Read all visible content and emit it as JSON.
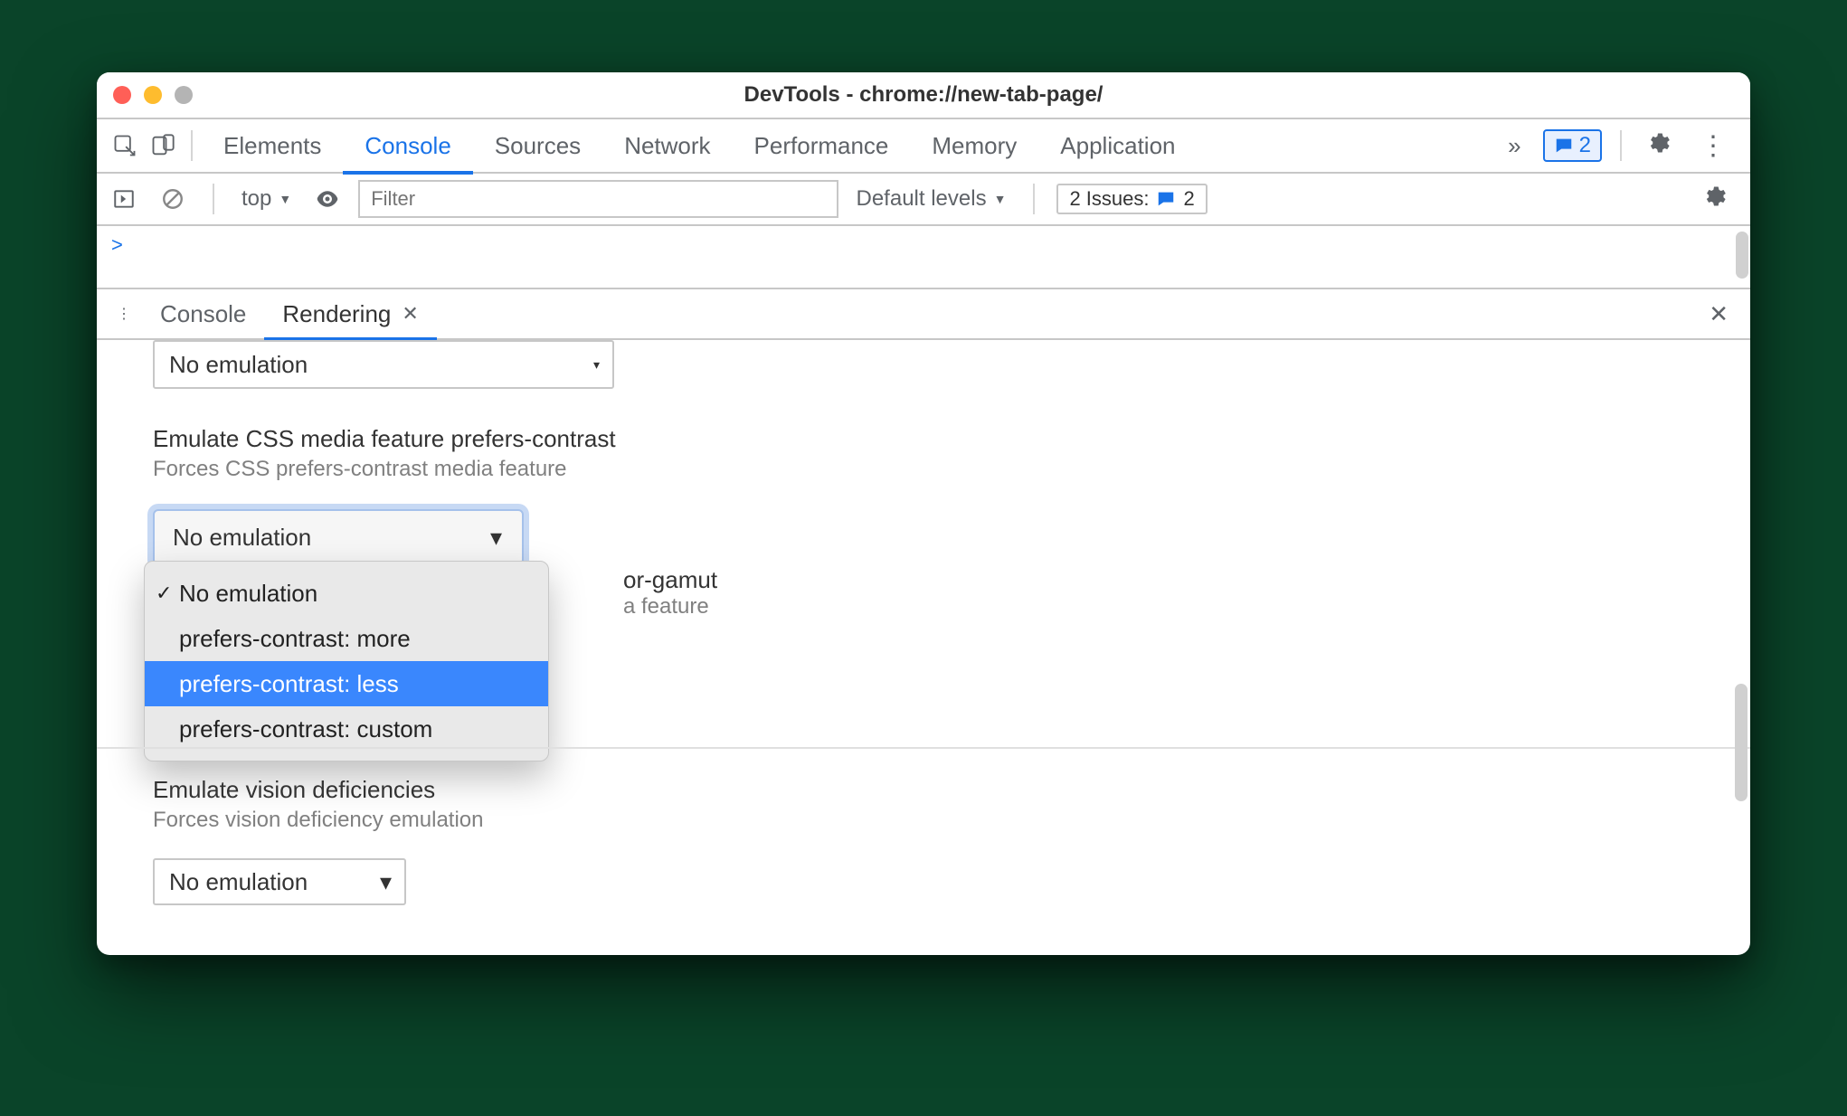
{
  "window": {
    "title": "DevTools - chrome://new-tab-page/"
  },
  "tabs": [
    {
      "label": "Elements"
    },
    {
      "label": "Console",
      "active": true
    },
    {
      "label": "Sources"
    },
    {
      "label": "Network"
    },
    {
      "label": "Performance"
    },
    {
      "label": "Memory"
    },
    {
      "label": "Application"
    }
  ],
  "tabsRight": {
    "messagesCount": "2",
    "overflow": "»"
  },
  "consoleBar": {
    "context": "top",
    "filterPlaceholder": "Filter",
    "levels": "Default levels",
    "issuesLabel": "2 Issues:",
    "issuesCount": "2"
  },
  "consolePrompt": ">",
  "drawer": {
    "tabs": [
      {
        "label": "Console"
      },
      {
        "label": "Rendering",
        "active": true,
        "closable": true
      }
    ]
  },
  "rendering": {
    "select0": "No emulation",
    "sec1": {
      "title": "Emulate CSS media feature prefers-contrast",
      "desc": "Forces CSS prefers-contrast media feature",
      "selected": "No emulation",
      "options": [
        {
          "label": "No emulation",
          "checked": true
        },
        {
          "label": "prefers-contrast: more"
        },
        {
          "label": "prefers-contrast: less",
          "hl": true
        },
        {
          "label": "prefers-contrast: custom"
        }
      ]
    },
    "sec2": {
      "titleTail": "or-gamut",
      "descTail": "a feature"
    },
    "sec3": {
      "title": "Emulate vision deficiencies",
      "desc": "Forces vision deficiency emulation",
      "selected": "No emulation"
    }
  }
}
